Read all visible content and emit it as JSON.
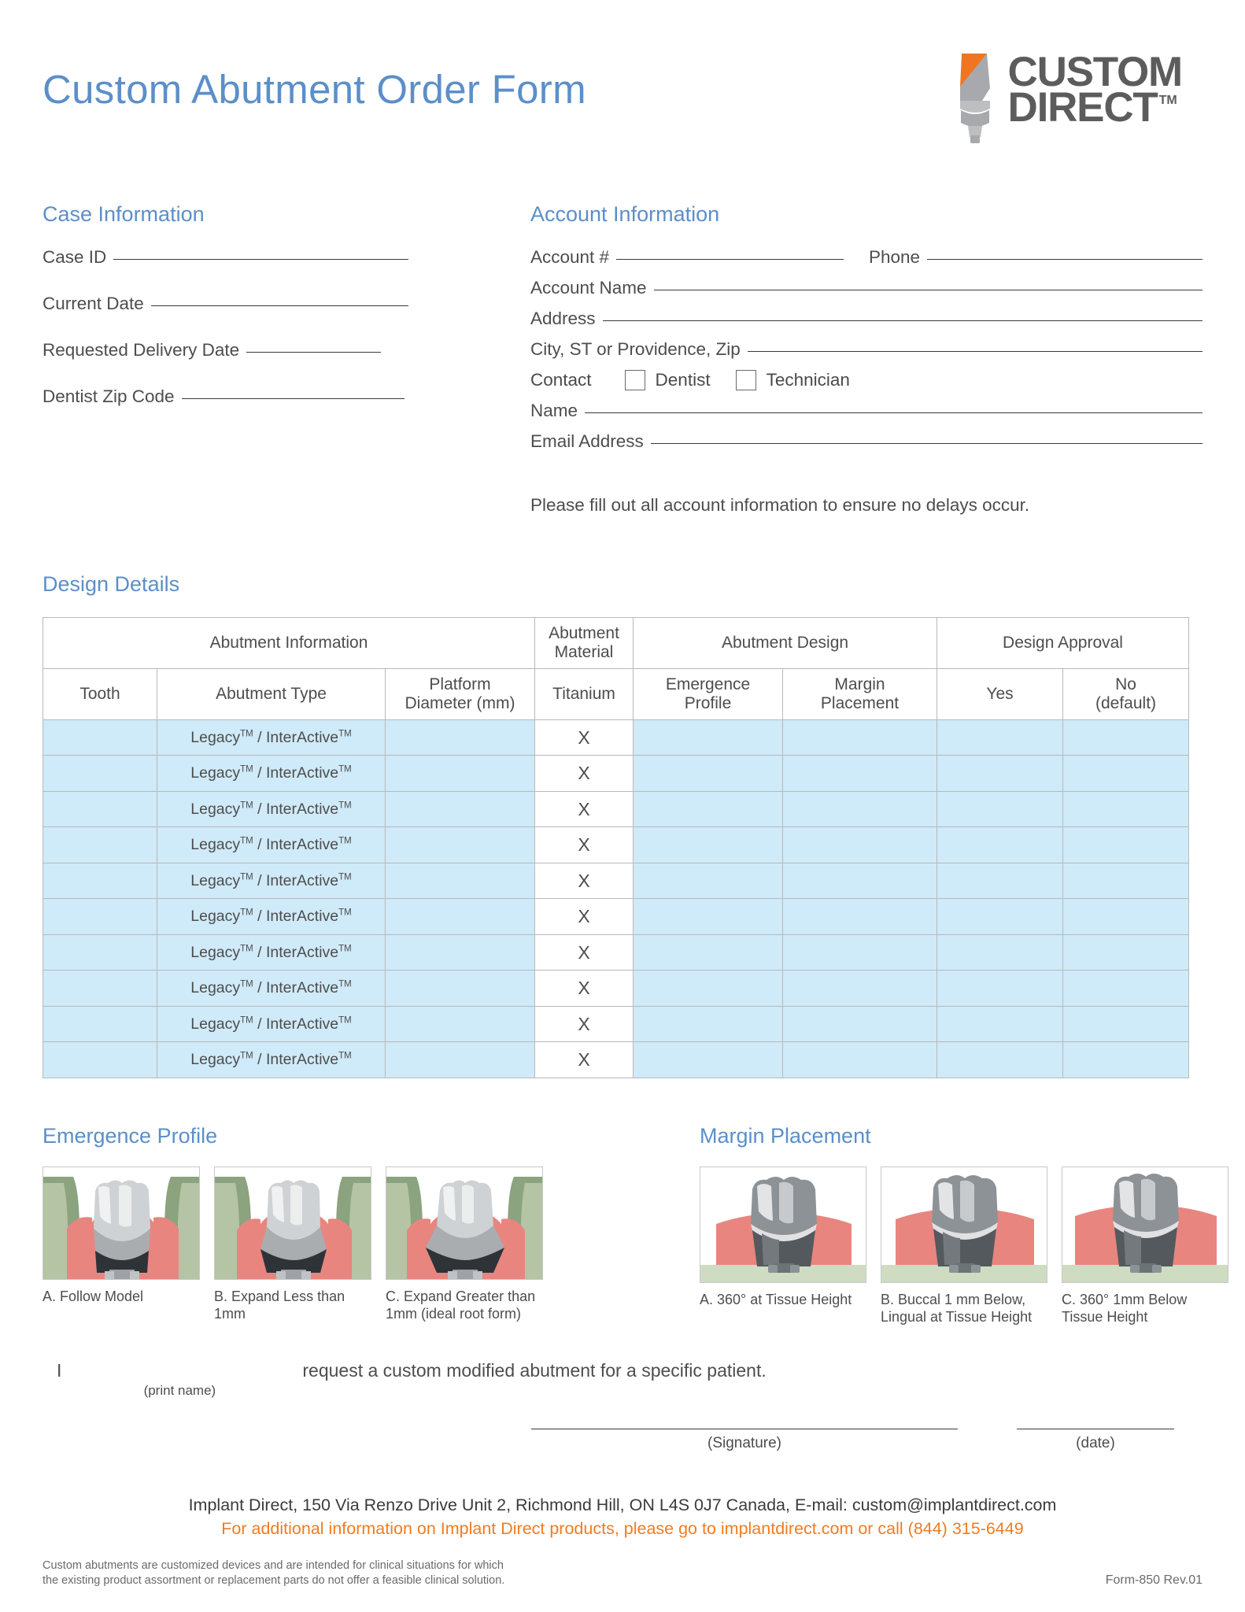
{
  "header": {
    "title": "Custom Abutment Order Form",
    "logo": {
      "word1": "CUSTOM",
      "word2": "DIRECT",
      "tm": "TM",
      "orange": "#ee7623",
      "gray": "#a7a9ac",
      "text_gray": "#5c5c5c"
    }
  },
  "case_information": {
    "heading": "Case Information",
    "fields": [
      {
        "label": "Case ID"
      },
      {
        "label": "Current Date"
      },
      {
        "label": "Requested Delivery Date"
      },
      {
        "label": "Dentist Zip Code"
      }
    ]
  },
  "account_information": {
    "heading": "Account Information",
    "account_number_label": "Account #",
    "phone_label": "Phone",
    "account_name_label": "Account Name",
    "address_label": "Address",
    "city_label": "City, ST or Providence, Zip",
    "contact_label": "Contact",
    "dentist_label": "Dentist",
    "technician_label": "Technician",
    "name_label": "Name",
    "email_label": "Email Address",
    "note": "Please fill out all account information to ensure no delays occur."
  },
  "design_details": {
    "heading": "Design Details",
    "group_headers": [
      "Abutment Information",
      "Abutment Material",
      "Abutment Design",
      "Design Approval"
    ],
    "column_headers": [
      "Tooth",
      "Abutment Type",
      "Platform Diameter (mm)",
      "Titanium",
      "Emergence Profile",
      "Margin Placement",
      "Yes",
      "No (default)"
    ],
    "column_headers_multiline": {
      "platform_1": "Platform",
      "platform_2": "Diameter (mm)",
      "emergence_1": "Emergence",
      "emergence_2": "Profile",
      "margin_1": "Margin",
      "margin_2": "Placement",
      "no_1": "No",
      "no_2": "(default)",
      "material_1": "Abutment",
      "material_2": "Material"
    },
    "row_count": 10,
    "abutment_type_text": "Legacy",
    "abutment_type_sep": " / ",
    "abutment_type_text2": "InterActive",
    "trademark": "TM",
    "titanium_mark": "X",
    "row_fill_color": "#cfeaf8"
  },
  "emergence_profile": {
    "heading": "Emergence Profile",
    "items": [
      {
        "caption": "A. Follow Model"
      },
      {
        "caption": "B. Expand Less than 1mm"
      },
      {
        "caption": "C. Expand Greater than 1mm (ideal root form)"
      }
    ]
  },
  "margin_placement": {
    "heading": "Margin Placement",
    "items": [
      {
        "caption": "A. 360° at Tissue Height"
      },
      {
        "caption": "B. Buccal 1 mm Below, Lingual at Tissue Height"
      },
      {
        "caption": "C. 360° 1mm Below Tissue Height"
      }
    ]
  },
  "request_statement": {
    "prefix": "I",
    "print_name_caption": "(print name)",
    "suffix": "request a custom modified abutment for a specific patient."
  },
  "signature": {
    "signature_caption": "(Signature)",
    "date_caption": "(date)"
  },
  "footer": {
    "line1": "Implant Direct, 150 Via Renzo Drive Unit 2, Richmond Hill, ON L4S 0J7 Canada, E-mail: custom@implantdirect.com",
    "line2": "For additional information on Implant Direct products, please go to implantdirect.com or call (844) 315-6449",
    "orange_color": "#f07c22",
    "disclaimer_line1": "Custom abutments are customized devices and are intended for clinical situations for which",
    "disclaimer_line2": "the existing product assortment or replacement parts do not offer a feasible clinical solution.",
    "form_revision": "Form-850 Rev.01"
  },
  "colors": {
    "accent_blue": "#5b8fc9",
    "row_blue": "#cfeaf8",
    "border_gray": "#b9b9b9",
    "text": "#4d4d4d"
  }
}
